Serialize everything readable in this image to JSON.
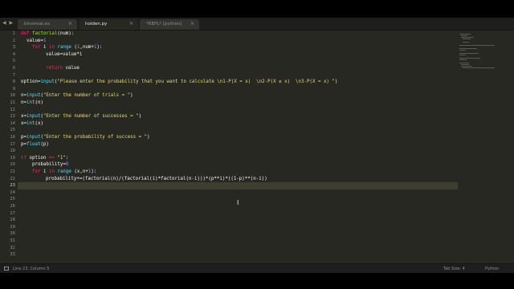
{
  "tabs": [
    {
      "label": "binomial.ex"
    },
    {
      "label": "holden.py"
    },
    {
      "label": "*REPL* [python]"
    }
  ],
  "gutter": [
    "1",
    "2",
    "3",
    "4",
    "5",
    "6",
    "7",
    "8",
    "9",
    "10",
    "11",
    "12",
    "13",
    "14",
    "15",
    "16",
    "17",
    "18",
    "19",
    "20",
    "21",
    "22",
    "23",
    "24",
    "25",
    "26",
    "27",
    "28",
    "29",
    "30",
    "31",
    "32",
    "33"
  ],
  "code": {
    "l1": [
      "def",
      " ",
      "factorial",
      "(num):"
    ],
    "l2": [
      "value=",
      "1"
    ],
    "l3": [
      "for",
      " i ",
      "in",
      " ",
      "range",
      " (",
      "1",
      ",num+",
      "1",
      "):"
    ],
    "l4": [
      "value=value*i"
    ],
    "l6": [
      "return",
      " value"
    ],
    "l8": [
      "option=",
      "input",
      "(",
      "\"Please enter the probability that you want to calculate \\n1-P(X = x)  \\n2-P(X ≤ x)  \\n3-P(X = x) \"",
      ")"
    ],
    "l10": [
      "n=",
      "input",
      "(",
      "\"Enter the number of trials = \"",
      ")"
    ],
    "l11": [
      "n=",
      "int",
      "(n)"
    ],
    "l13": [
      "x=",
      "input",
      "(",
      "\"Enter the number of successes = \"",
      ")"
    ],
    "l14": [
      "x=",
      "int",
      "(x)"
    ],
    "l16": [
      "p=",
      "input",
      "(",
      "\"Enter the probability of success = \"",
      ")"
    ],
    "l17": [
      "p=",
      "float",
      "(p)"
    ],
    "l19": [
      "if",
      " option ",
      "==",
      " ",
      "\"1\"",
      ":"
    ],
    "l20": [
      "probability=",
      "0"
    ],
    "l21": [
      "for",
      " i ",
      "in",
      " ",
      "range",
      " (x,n+",
      "1",
      "):"
    ],
    "l22": [
      "probability+=(factorial(n)/(factorial(i)*factorial(n-i)))*(p**i)*((1-p)**(n-i))"
    ]
  },
  "status": {
    "position": "Line 23, Column 5",
    "tab_size": "Tab Size: 4",
    "syntax": "Python"
  },
  "colors": {
    "background": "#272822",
    "keyword": "#f92672",
    "function": "#a6e22e",
    "builtin": "#66d9ef",
    "string": "#e6db74",
    "number": "#ae81ff"
  }
}
